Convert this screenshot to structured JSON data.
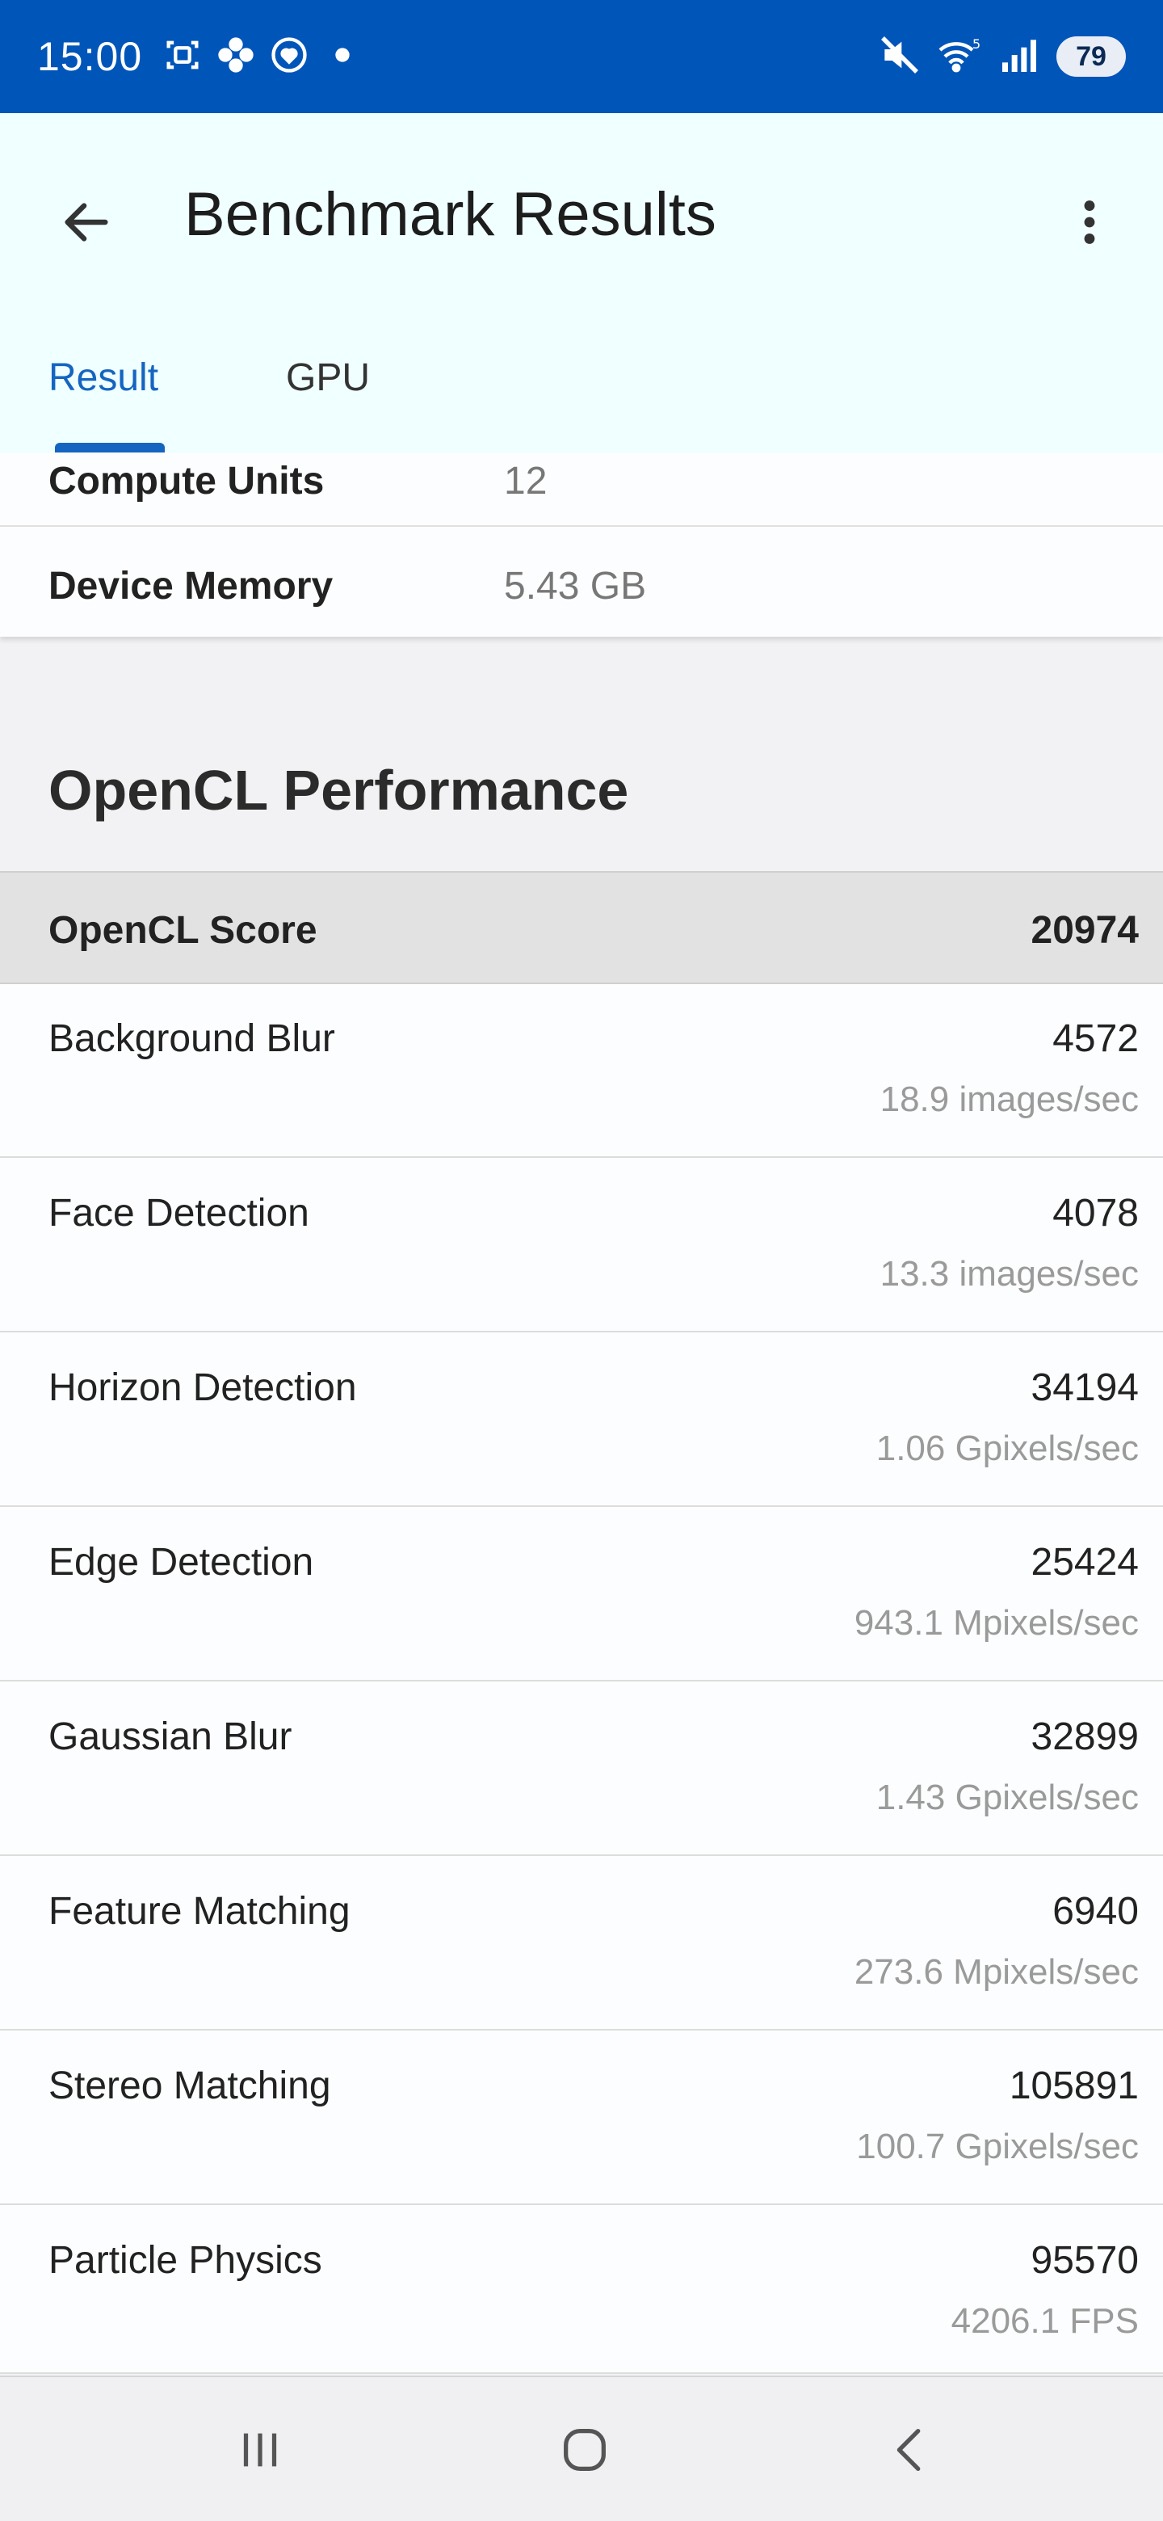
{
  "status_bar": {
    "time": "15:00",
    "left_icons": [
      "screenshot-icon",
      "flower-icon",
      "heart-circle-icon",
      "dot-icon"
    ],
    "right_icons": [
      "mute-icon",
      "wifi-icon",
      "signal-icon"
    ],
    "wifi_badge": "5",
    "battery": "79"
  },
  "app_bar": {
    "title": "Benchmark Results",
    "back_icon": "arrow-left-icon",
    "more_icon": "more-vertical-icon"
  },
  "tabs": [
    {
      "label": "Result",
      "active": true
    },
    {
      "label": "GPU",
      "active": false
    }
  ],
  "device_info": [
    {
      "key": "Compute Units",
      "value": "12"
    },
    {
      "key": "Device Memory",
      "value": "5.43 GB"
    }
  ],
  "section": {
    "title": "OpenCL Performance"
  },
  "score": {
    "label": "OpenCL Score",
    "value": "20974"
  },
  "results": [
    {
      "name": "Background Blur",
      "score": "4572",
      "rate": "18.9 images/sec"
    },
    {
      "name": "Face Detection",
      "score": "4078",
      "rate": "13.3 images/sec"
    },
    {
      "name": "Horizon Detection",
      "score": "34194",
      "rate": "1.06 Gpixels/sec"
    },
    {
      "name": "Edge Detection",
      "score": "25424",
      "rate": "943.1 Mpixels/sec"
    },
    {
      "name": "Gaussian Blur",
      "score": "32899",
      "rate": "1.43 Gpixels/sec"
    },
    {
      "name": "Feature Matching",
      "score": "6940",
      "rate": "273.6 Mpixels/sec"
    },
    {
      "name": "Stereo Matching",
      "score": "105891",
      "rate": "100.7 Gpixels/sec"
    },
    {
      "name": "Particle Physics",
      "score": "95570",
      "rate": "4206.1 FPS"
    }
  ],
  "nav_bar": {
    "icons": [
      "recents-icon",
      "home-icon",
      "back-icon"
    ]
  },
  "colors": {
    "status_bar": "#0055b8",
    "app_bar": "#f0ffff",
    "accent": "#1565c0"
  }
}
